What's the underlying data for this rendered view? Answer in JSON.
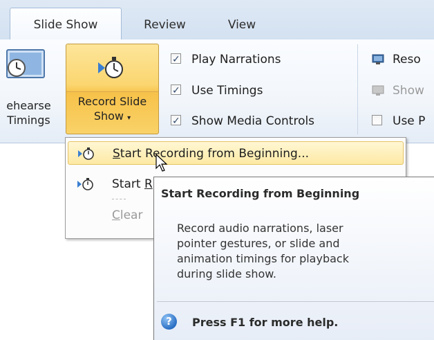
{
  "tabs": [
    {
      "label": "Slide Show",
      "active": true
    },
    {
      "label": "Review",
      "active": false
    },
    {
      "label": "View",
      "active": false
    }
  ],
  "ribbon": {
    "rehearse_line1": "ehearse",
    "rehearse_line2": "Timings",
    "record_line1": "Record Slide",
    "record_line2": "Show",
    "checkboxes": [
      {
        "label": "Play Narrations",
        "checked": true
      },
      {
        "label": "Use Timings",
        "checked": true
      },
      {
        "label": "Show Media Controls",
        "checked": true
      }
    ],
    "right_items": [
      {
        "label": "Reso",
        "icon": "monitor-icon"
      },
      {
        "label": "Show",
        "icon": "presenter-view-icon",
        "disabled": true
      },
      {
        "label": "Use P",
        "icon": "checkbox",
        "checked": false
      }
    ]
  },
  "menu": {
    "items": [
      {
        "prefix": "",
        "accel": "S",
        "rest": "tart Recording from Beginning...",
        "highlighted": true
      },
      {
        "prefix": "Start ",
        "accel": "R",
        "rest": "",
        "highlighted": false
      },
      {
        "prefix": "",
        "accel": "C",
        "rest": "lear",
        "disabled": true
      }
    ]
  },
  "tooltip": {
    "title": "Start Recording from Beginning",
    "body_lines": [
      "Record audio narrations, laser",
      "pointer gestures, or slide and",
      "animation timings for playback",
      "during slide show."
    ],
    "help": "Press F1 for more help."
  },
  "colors": {
    "accent_orange": "#f7c24a",
    "ribbon_blue": "#dfe9f5",
    "help_blue": "#2b6fc4"
  }
}
